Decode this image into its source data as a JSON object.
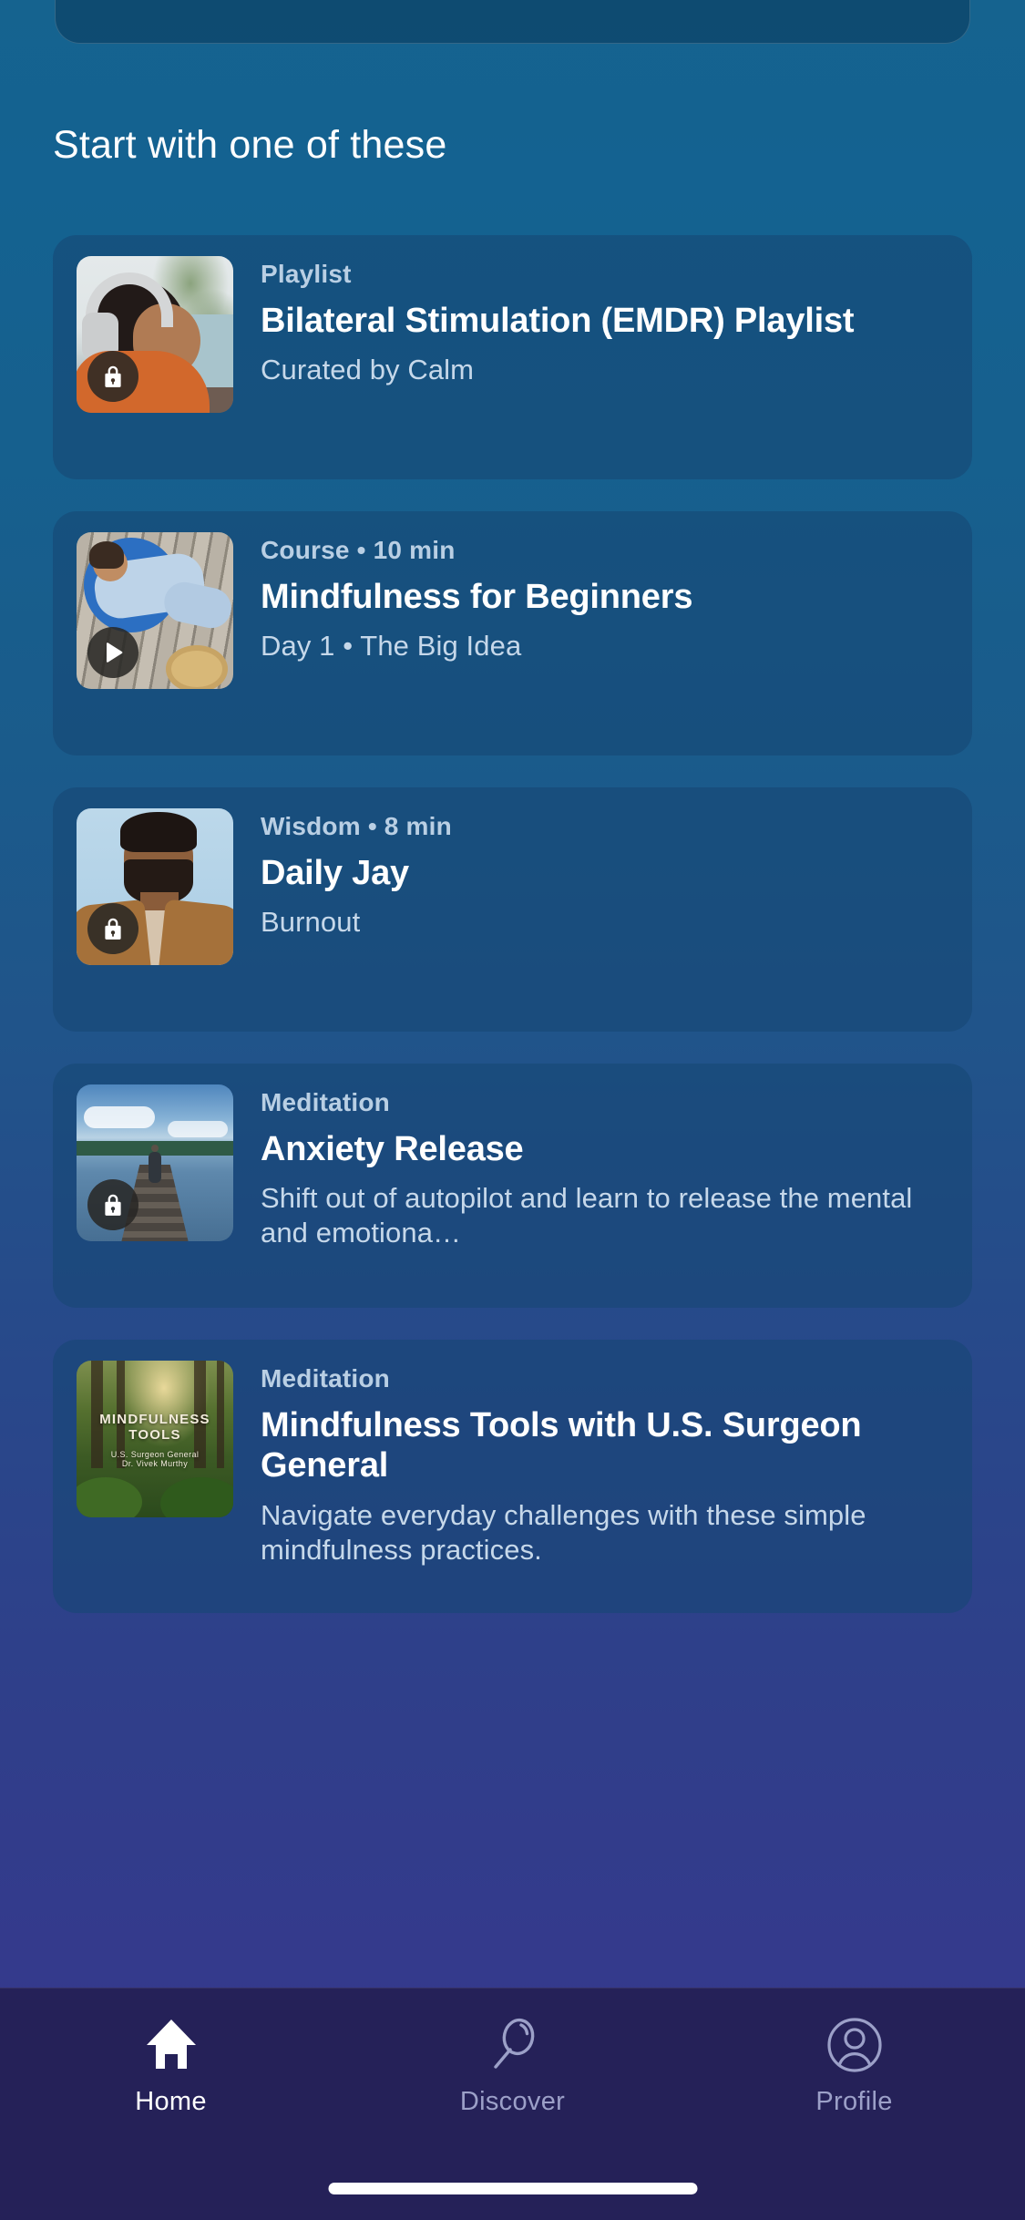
{
  "section": {
    "heading": "Start with one of these"
  },
  "cards": [
    {
      "kicker": "Playlist",
      "title": "Bilateral Stimulation (EMDR) Playlist",
      "subtitle": "Curated by Calm",
      "badge": "lock-icon",
      "art": "woman-with-headphones"
    },
    {
      "kicker": "Course • 10 min",
      "title": "Mindfulness for Beginners",
      "subtitle": "Day 1 • The Big Idea",
      "badge": "play-icon",
      "art": "person-lying-on-deck"
    },
    {
      "kicker": "Wisdom • 8 min",
      "title": "Daily Jay",
      "subtitle": "Burnout",
      "badge": "lock-icon",
      "art": "man-in-tan-jacket"
    },
    {
      "kicker": "Meditation",
      "title": "Anxiety Release",
      "subtitle": "Shift out of autopilot and learn to release the mental and emotiona…",
      "badge": "lock-icon",
      "art": "person-on-dock"
    },
    {
      "kicker": "Meditation",
      "title": "Mindfulness Tools with U.S. Surgeon General",
      "subtitle": "Navigate everyday challenges with these simple mindfulness practices.",
      "badge": "none",
      "art": "forest-cover",
      "cover": {
        "line1": "MINDFULNESS",
        "line2": "TOOLS",
        "line3": "U.S. Surgeon General",
        "line4": "Dr. Vivek Murthy"
      }
    }
  ],
  "tabbar": {
    "items": [
      {
        "label": "Home",
        "icon": "home-icon",
        "active": true
      },
      {
        "label": "Discover",
        "icon": "search-icon",
        "active": false
      },
      {
        "label": "Profile",
        "icon": "person-circle-icon",
        "active": false
      }
    ]
  },
  "colors": {
    "background_top": "#15638f",
    "background_bottom": "#33358a",
    "card": "#164673",
    "tabbar": "#252158",
    "accent_text": "#ffffff",
    "muted_text": "#b9cfe4"
  }
}
